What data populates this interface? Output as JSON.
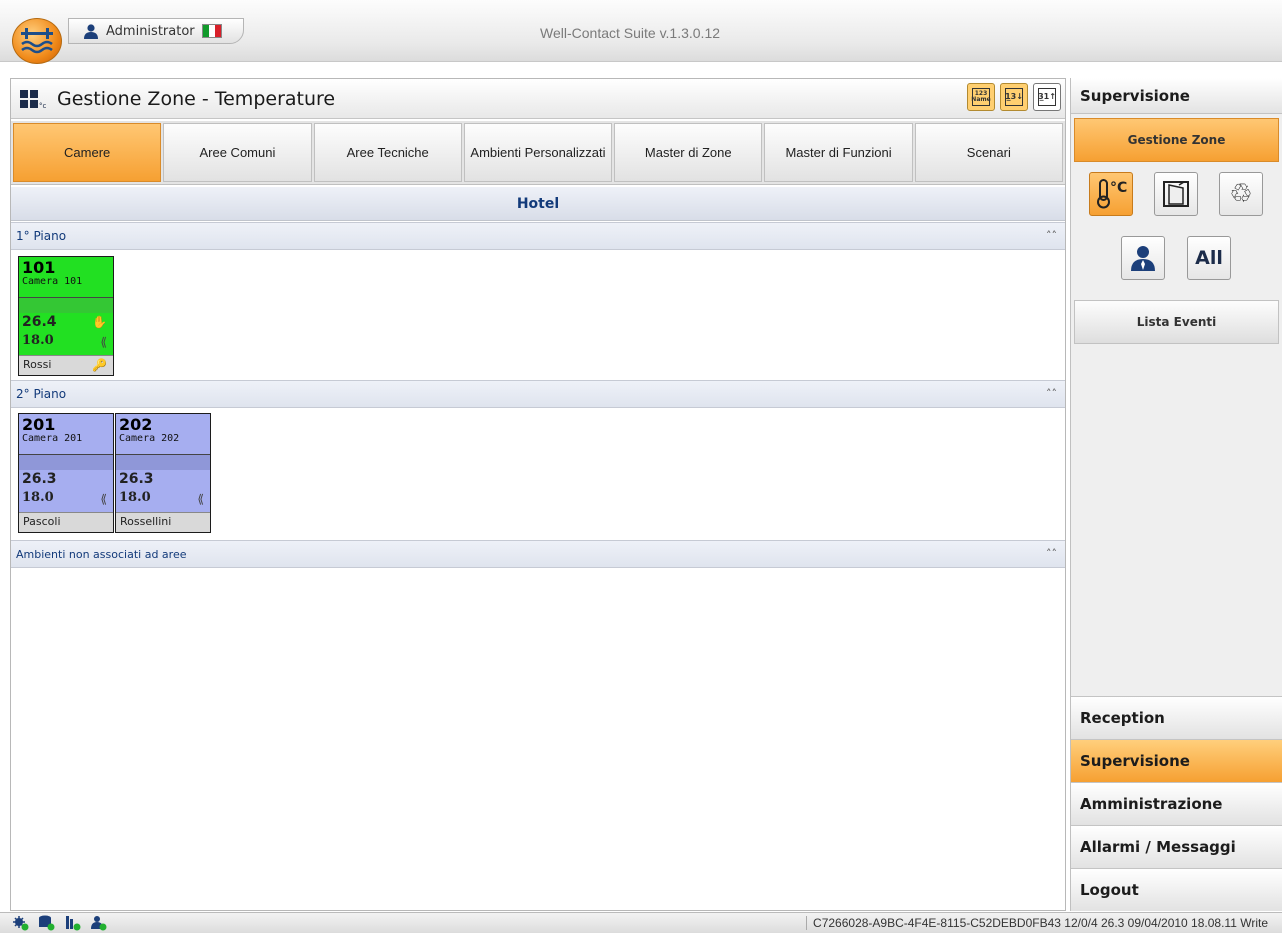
{
  "window": {
    "title": "Well-Contact Suite v.1.3.0.12",
    "user": "Administrator"
  },
  "page": {
    "title": "Gestione Zone - Temperature",
    "sort_buttons": [
      {
        "label": "123 Name"
      },
      {
        "label": "1 3 ↓"
      },
      {
        "label": "3 1 ↑"
      }
    ]
  },
  "tabs": [
    "Camere",
    "Aree Comuni",
    "Aree Tecniche",
    "Ambienti Personalizzati",
    "Master di Zone",
    "Master di Funzioni",
    "Scenari"
  ],
  "hotel": {
    "name": "Hotel"
  },
  "floors": [
    {
      "name": "1° Piano"
    },
    {
      "name": "2° Piano"
    },
    {
      "name": "Ambienti non associati ad aree"
    }
  ],
  "rooms": [
    {
      "number": "101",
      "name": "Camera 101",
      "temp": "26.4",
      "setpoint": "18.0",
      "owner": "Rossi",
      "color": "#22e022"
    },
    {
      "number": "201",
      "name": "Camera 201",
      "temp": "26.3",
      "setpoint": "18.0",
      "owner": "Pascoli",
      "color": "#a6aef0"
    },
    {
      "number": "202",
      "name": "Camera 202",
      "temp": "26.3",
      "setpoint": "18.0",
      "owner": "Rossellini",
      "color": "#a6aef0"
    }
  ],
  "sidebar": {
    "header": "Supervisione",
    "gestione_zone": "Gestione Zone",
    "icons": [
      "thermometer-celsius-icon",
      "door-window-icon",
      "recycle-icon",
      "person-icon",
      "all-icon"
    ],
    "all_label": "All",
    "lista_eventi": "Lista Eventi",
    "nav": [
      "Reception",
      "Supervisione",
      "Amministrazione",
      "Allarmi / Messaggi",
      "Logout"
    ]
  },
  "status": {
    "text": "C7266028-A9BC-4F4E-8115-C52DEBD0FB43 12/0/4 26.3 09/04/2010 18.08.11 Write"
  },
  "colors": {
    "accent": "#f6a032",
    "room_occupied": "#22e022",
    "room_free": "#a6aef0"
  }
}
